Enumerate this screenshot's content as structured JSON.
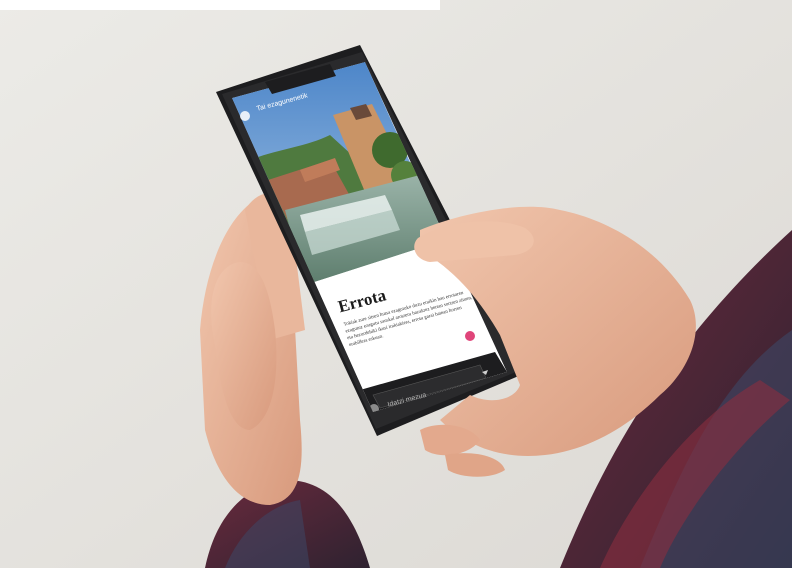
{
  "scene": {
    "description_colors": {
      "background": "#e9e7e3",
      "phone_body": "#1d1d1f",
      "skin": "#e8b49a",
      "shirt_dark": "#3a2430",
      "shirt_red": "#7a2a3a",
      "accent_pink": "#e0457a"
    }
  },
  "phone": {
    "app_title": "Tai ezagunenetik",
    "article": {
      "title": "Errota",
      "body": "Tokiak zure sitsen hutsa ezagutuko duzu eraikin hau errotaren ezagutuz ezagutu sauskal arotzera bazakrez bertan sortzen zituen, eta hezurdehiki ikusi irakiakiera, errota garai batean horren erabillera eskuan."
    },
    "message_input": {
      "placeholder": "Idatzi mezua"
    },
    "icons": [
      "chat-icon",
      "share-icon",
      "fab-icon",
      "settings-icon"
    ]
  }
}
